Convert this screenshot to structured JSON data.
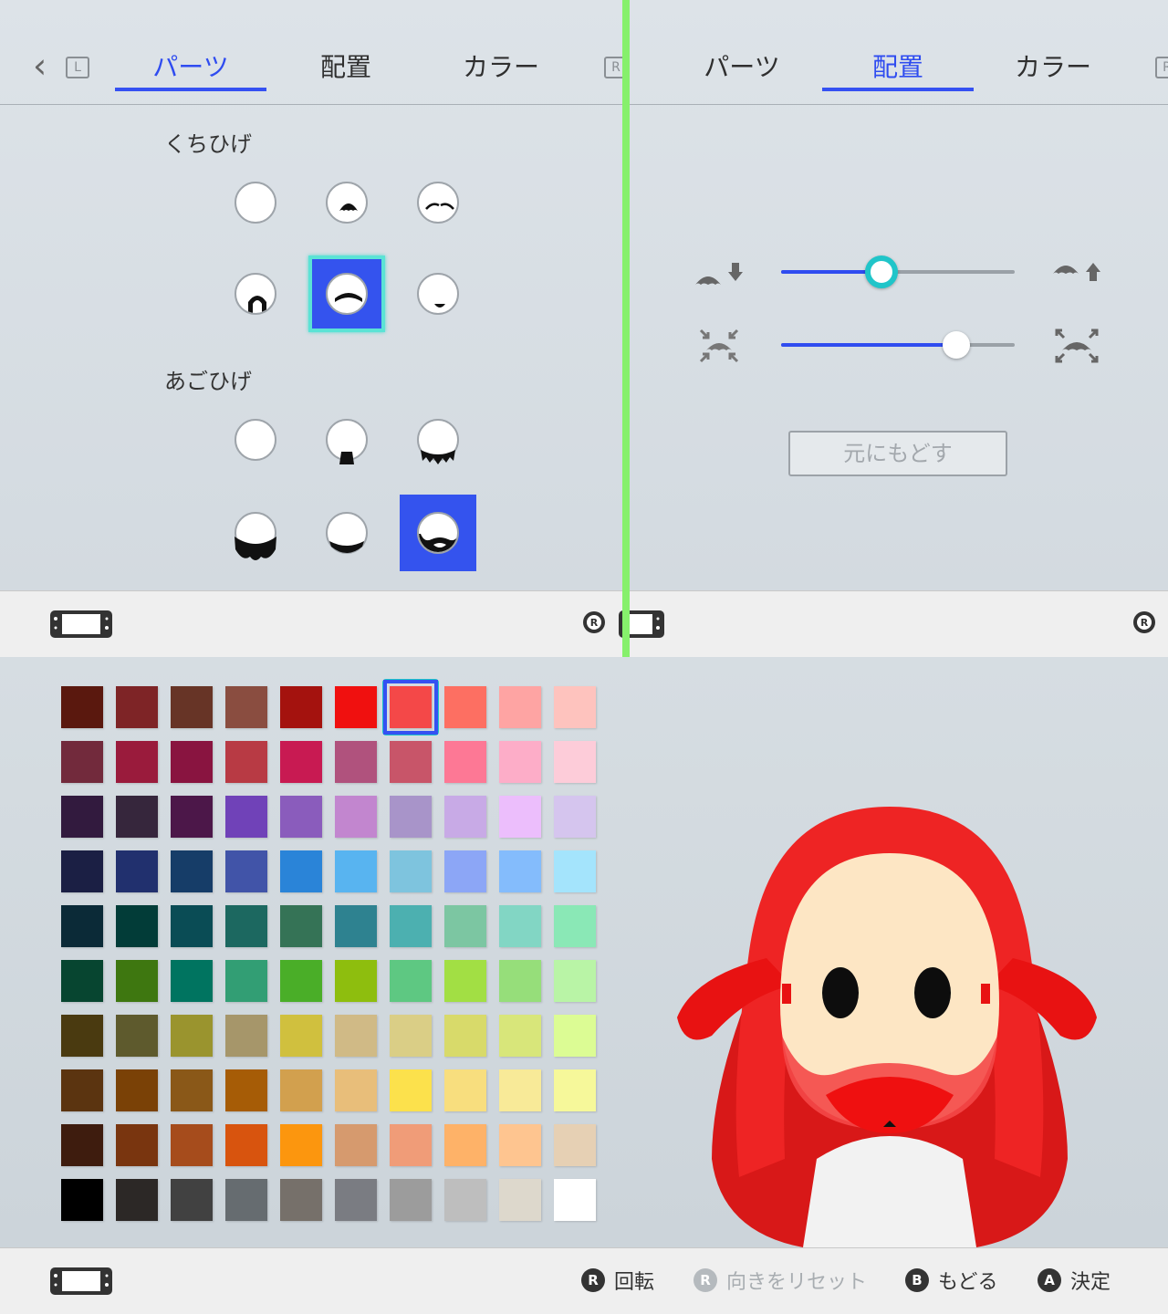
{
  "left_panel": {
    "tabs": [
      {
        "label": "パーツ",
        "active": true
      },
      {
        "label": "配置",
        "active": false
      },
      {
        "label": "カラー",
        "active": false
      }
    ],
    "shoulder_left": "L",
    "shoulder_right": "R",
    "mustache_title": "くちひげ",
    "beard_title": "あごひげ",
    "mustache_options": [
      "none",
      "style-1",
      "style-2",
      "style-3",
      "style-4",
      "style-5"
    ],
    "mustache_selected": 4,
    "beard_options": [
      "none",
      "style-1",
      "style-2",
      "style-3",
      "style-4",
      "style-5"
    ],
    "beard_selected": 5
  },
  "right_panel": {
    "tabs": [
      {
        "label": "パーツ",
        "active": false
      },
      {
        "label": "配置",
        "active": true
      },
      {
        "label": "カラー",
        "active": false
      }
    ],
    "shoulder_right": "R",
    "position_slider": {
      "value": 0.43
    },
    "size_slider": {
      "value": 0.75
    },
    "reset_label": "元にもどす"
  },
  "color_palette": {
    "selected_index": 6,
    "rows": [
      [
        "#5a180e",
        "#7e2426",
        "#673426",
        "#8a4d40",
        "#a4120e",
        "#f0100f",
        "#f44848",
        "#fd6f62",
        "#fea4a3",
        "#fec3be"
      ],
      [
        "#722a3c",
        "#9a1b3c",
        "#891440",
        "#b83a44",
        "#c81a52",
        "#b0527d",
        "#c85569",
        "#fd7895",
        "#fdadc8",
        "#fdccd9"
      ],
      [
        "#321a3e",
        "#36263c",
        "#4c1749",
        "#7042b8",
        "#8a5cbc",
        "#c286cf",
        "#a894c9",
        "#c8aae6",
        "#ecbefc",
        "#d5c5ee"
      ],
      [
        "#1b1f44",
        "#21306e",
        "#163d68",
        "#4154a8",
        "#2a84d8",
        "#58b4f0",
        "#7ec4de",
        "#8ca6f6",
        "#84bcfc",
        "#a4e4fc"
      ],
      [
        "#0b2a37",
        "#023c38",
        "#0a4c55",
        "#1c6860",
        "#357356",
        "#2e8290",
        "#4cb0b0",
        "#7cc6a2",
        "#82d6c4",
        "#8ae8b6"
      ],
      [
        "#074530",
        "#3e7710",
        "#007460",
        "#329e74",
        "#4aae28",
        "#8ebe0e",
        "#5ec882",
        "#a2df44",
        "#96de7a",
        "#b9f4a6"
      ],
      [
        "#4a3a10",
        "#5e5a2d",
        "#9a942e",
        "#a6966a",
        "#d0c03e",
        "#d0ba86",
        "#dace86",
        "#d8da6a",
        "#d8e67a",
        "#dcfc94"
      ],
      [
        "#5b3410",
        "#7a4106",
        "#8a5818",
        "#a65c06",
        "#d2a04e",
        "#e8be7a",
        "#fce14c",
        "#f8de7e",
        "#f8ea98",
        "#f6f89a"
      ],
      [
        "#3e1c0e",
        "#79350f",
        "#a64c1c",
        "#d8540e",
        "#fc960e",
        "#d69a6e",
        "#f09c78",
        "#feb268",
        "#fec590",
        "#e6d0b4"
      ],
      [
        "#000000",
        "#2c2826",
        "#414141",
        "#666c70",
        "#76706a",
        "#7a7c82",
        "#9c9c9c",
        "#bebebe",
        "#ddd8cc",
        "#ffffff"
      ]
    ]
  },
  "hints": {
    "rotate": "回転",
    "reset_direction": "向きをリセット",
    "back": "もどる",
    "confirm": "決定",
    "rotate_button": "R",
    "reset_button": "R",
    "back_button": "B",
    "confirm_button": "A"
  },
  "avatar": {
    "hair_color": "#ee2424",
    "beard_color": "#f44848",
    "skin_color": "#fde6c4"
  }
}
